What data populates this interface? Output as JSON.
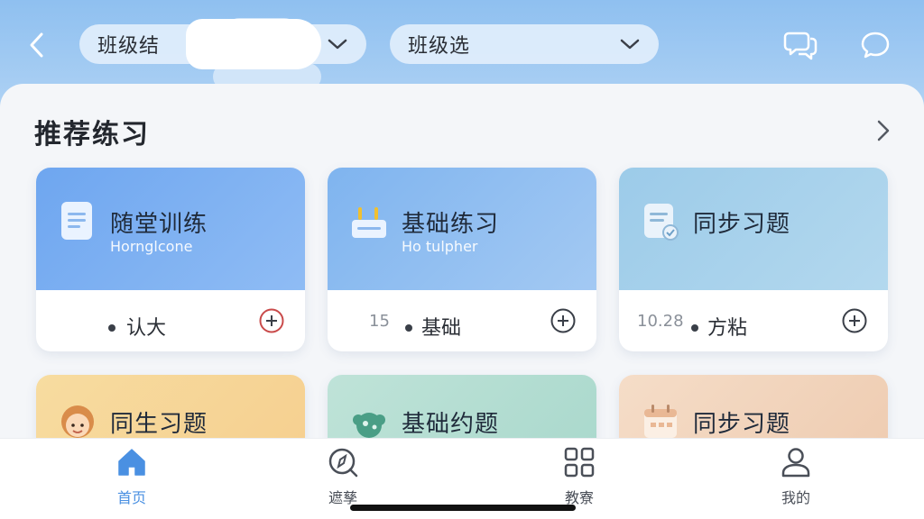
{
  "header": {
    "filter_class_result": "班级结",
    "filter_class_select": "班级选",
    "icons": [
      "chevron-left-icon",
      "chevron-down-icon",
      "chat-bubbles-icon",
      "chat-bubble-icon"
    ]
  },
  "section": {
    "title": "推荐练习"
  },
  "cards": [
    {
      "title": "随堂训练",
      "subtitle": "Hornglcone",
      "number": "",
      "tag": "认大",
      "icon": "document-icon"
    },
    {
      "title": "基础练习",
      "subtitle": "Ho tulpher",
      "number": "15",
      "tag": "基础",
      "icon": "tray-icon"
    },
    {
      "title": "同步习题",
      "subtitle": "",
      "number": "10.28",
      "tag": "方粘",
      "icon": "document-check-icon"
    },
    {
      "title": "同生习题",
      "icon": "girl-avatar-icon"
    },
    {
      "title": "基础约题",
      "icon": "blob-icon"
    },
    {
      "title": "同步习题",
      "icon": "calendar-icon"
    }
  ],
  "tabbar": {
    "items": [
      {
        "label": "首页",
        "icon": "home-icon",
        "active": true
      },
      {
        "label": "遮孳",
        "icon": "compass-icon",
        "active": false
      },
      {
        "label": "教寮",
        "icon": "grid-icon",
        "active": false
      },
      {
        "label": "我的",
        "icon": "user-icon",
        "active": false
      }
    ]
  },
  "colors": {
    "accent": "#4a90e2",
    "sky": "#8fc0f0"
  }
}
